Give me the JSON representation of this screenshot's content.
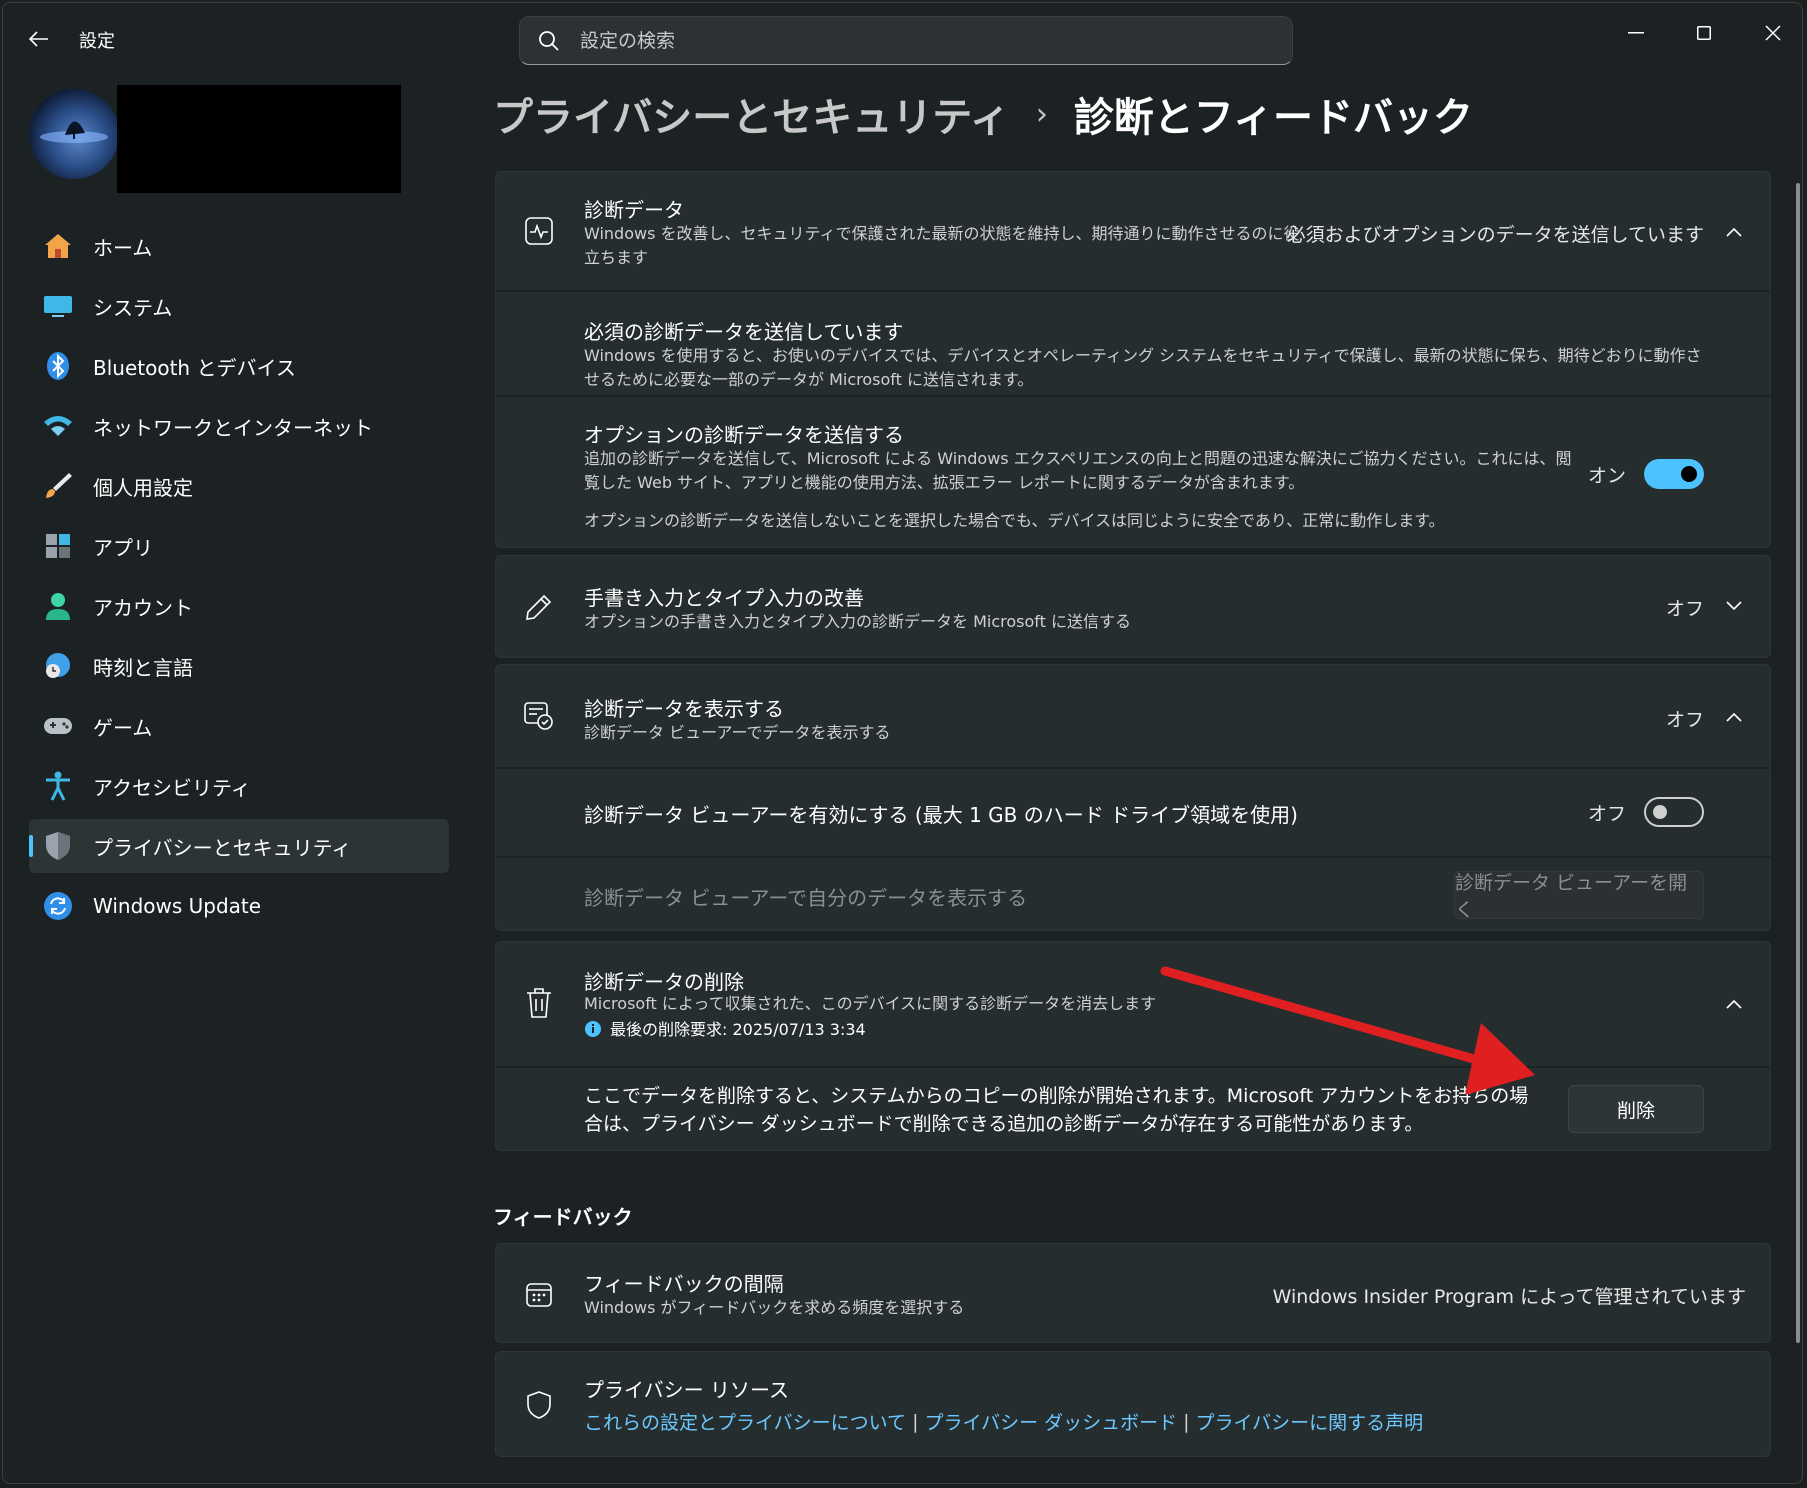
{
  "app": {
    "title": "設定"
  },
  "search": {
    "placeholder": "設定の検索"
  },
  "sidebar": {
    "items": [
      {
        "label": "ホーム",
        "icon": "home-icon"
      },
      {
        "label": "システム",
        "icon": "monitor-icon"
      },
      {
        "label": "Bluetooth とデバイス",
        "icon": "bluetooth-icon"
      },
      {
        "label": "ネットワークとインターネット",
        "icon": "wifi-icon"
      },
      {
        "label": "個人用設定",
        "icon": "brush-icon"
      },
      {
        "label": "アプリ",
        "icon": "apps-icon"
      },
      {
        "label": "アカウント",
        "icon": "account-icon"
      },
      {
        "label": "時刻と言語",
        "icon": "globe-clock-icon"
      },
      {
        "label": "ゲーム",
        "icon": "gamepad-icon"
      },
      {
        "label": "アクセシビリティ",
        "icon": "accessibility-icon"
      },
      {
        "label": "プライバシーとセキュリティ",
        "icon": "shield-icon",
        "active": true
      },
      {
        "label": "Windows Update",
        "icon": "update-icon"
      }
    ]
  },
  "breadcrumb": {
    "parent": "プライバシーとセキュリティ",
    "separator": "›",
    "current": "診断とフィードバック"
  },
  "diagnostic": {
    "title": "診断データ",
    "desc": "Windows を改善し、セキュリティで保護された最新の状態を維持し、期待通りに動作させるのに役立ちます",
    "status": "必須およびオプションのデータを送信しています",
    "required": {
      "title": "必須の診断データを送信しています",
      "desc": "Windows を使用すると、お使いのデバイスでは、デバイスとオペレーティング システムをセキュリティで保護し、最新の状態に保ち、期待どおりに動作させるために必要な一部のデータが Microsoft に送信されます。"
    },
    "optional": {
      "title": "オプションの診断データを送信する",
      "desc": "追加の診断データを送信して、Microsoft による Windows エクスペリエンスの向上と問題の迅速な解決にご協力ください。これには、閲覧した Web サイト、アプリと機能の使用方法、拡張エラー レポートに関するデータが含まれます。",
      "note": "オプションの診断データを送信しないことを選択した場合でも、デバイスは同じように安全であり、正常に動作します。",
      "toggle_label": "オン"
    }
  },
  "handwriting": {
    "title": "手書き入力とタイプ入力の改善",
    "desc": "オプションの手書き入力とタイプ入力の診断データを Microsoft に送信する",
    "status": "オフ"
  },
  "view_data": {
    "title": "診断データを表示する",
    "desc": "診断データ ビューアーでデータを表示する",
    "status": "オフ",
    "enable_label": "診断データ ビューアーを有効にする (最大 1 GB のハード ドライブ領域を使用)",
    "enable_toggle": "オフ",
    "view_label": "診断データ ビューアーで自分のデータを表示する",
    "open_button": "診断データ ビューアーを開く"
  },
  "delete": {
    "title": "診断データの削除",
    "desc": "Microsoft によって収集された、このデバイスに関する診断データを消去します",
    "last": "最後の削除要求: 2025/07/13 3:34",
    "body": "ここでデータを削除すると、システムからのコピーの削除が開始されます。Microsoft アカウントをお持ちの場合は、プライバシー ダッシュボードで削除できる追加の診断データが存在する可能性があります。",
    "button": "削除"
  },
  "feedback_section": {
    "label": "フィードバック"
  },
  "feedback_freq": {
    "title": "フィードバックの間隔",
    "desc": "Windows がフィードバックを求める頻度を選択する",
    "status": "Windows Insider Program によって管理されています"
  },
  "privacy_resources": {
    "title": "プライバシー リソース",
    "links": [
      "これらの設定とプライバシーについて",
      "プライバシー ダッシュボード",
      "プライバシーに関する声明"
    ],
    "sep": "|"
  },
  "colors": {
    "accent": "#4cc2ff",
    "arrow": "#e02020",
    "link": "#6cc9ff"
  }
}
